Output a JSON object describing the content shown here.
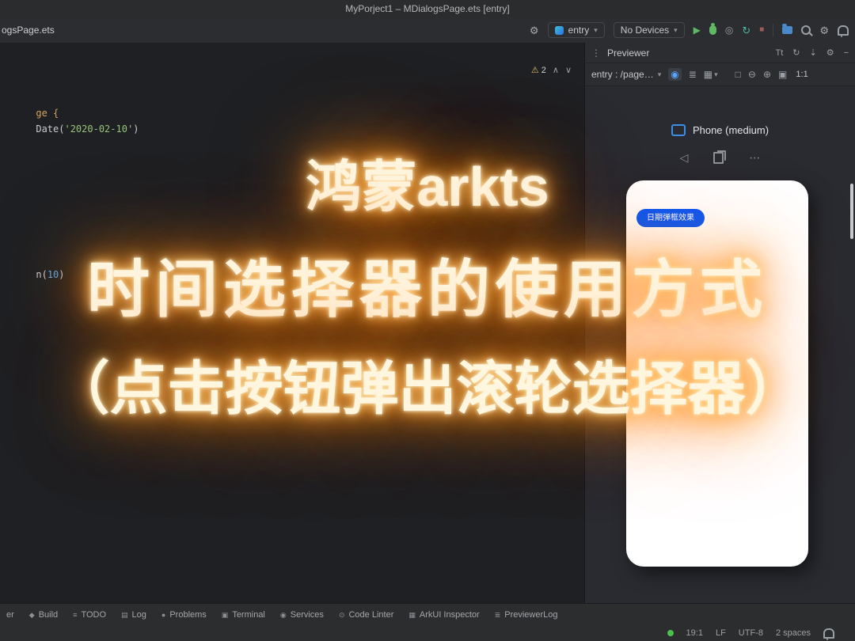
{
  "window": {
    "title": "MyPorject1 – MDialogsPage.ets [entry]"
  },
  "toolbar": {
    "tab_label": "ogsPage.ets",
    "run_config": "entry",
    "device_selector": "No Devices"
  },
  "editor": {
    "warnings": {
      "count": "2"
    },
    "code_fragments": [
      {
        "tokens": [
          {
            "text": "ge {",
            "color": "#d7a65f"
          }
        ]
      },
      {
        "tokens": [
          {
            "text": "Date(",
            "color": "#c9ccd1"
          },
          {
            "text": "'2020-02-10'",
            "color": "#98c379"
          },
          {
            "text": ")",
            "color": "#c9ccd1"
          }
        ]
      },
      {
        "tokens": [
          {
            "text": "n(",
            "color": "#c9ccd1"
          },
          {
            "text": "10",
            "color": "#56a8f5"
          },
          {
            "text": ")",
            "color": "#c9ccd1"
          }
        ]
      }
    ]
  },
  "previewer": {
    "title": "Previewer",
    "route": "entry : /page…",
    "font_icon": "Tt",
    "zoom_ratio": "1:1",
    "device_name": "Phone (medium)",
    "screen_button": "日期弹框效果"
  },
  "overlay": {
    "line1": "鸿蒙arkts",
    "line2": "时间选择器的使用方式",
    "line3": "（点击按钮弹出滚轮选择器）"
  },
  "statusbar": {
    "tools": [
      {
        "icon": "",
        "label": "er"
      },
      {
        "icon": "◆",
        "label": "Build"
      },
      {
        "icon": "≡",
        "label": "TODO"
      },
      {
        "icon": "▤",
        "label": "Log"
      },
      {
        "icon": "●",
        "label": "Problems"
      },
      {
        "icon": "▣",
        "label": "Terminal"
      },
      {
        "icon": "◉",
        "label": "Services"
      },
      {
        "icon": "⊙",
        "label": "Code Linter"
      },
      {
        "icon": "▦",
        "label": "ArkUI Inspector"
      },
      {
        "icon": "≣",
        "label": "PreviewerLog"
      }
    ],
    "caret_position": "19:1",
    "line_ending": "LF",
    "encoding": "UTF-8",
    "indent": "2 spaces"
  },
  "icons": {
    "gear": "⚙",
    "caret_down": "▾",
    "play": "▶",
    "profile": "◎",
    "refresh": "↻",
    "stop": "■",
    "warning": "⚠",
    "up": "∧",
    "down": "∨",
    "kebab": "⋮",
    "collapse": "⇣",
    "minimize": "−",
    "eye": "◉",
    "layers": "≣",
    "grid": "▦",
    "frame": "□",
    "zoom_out": "⊖",
    "zoom_in": "⊕",
    "fit": "▣",
    "back": "◁",
    "more": "⋯"
  },
  "colors": {
    "accent_blue": "#0a59f7",
    "glow_orange": "#ff8a12",
    "run_green": "#5fb865",
    "warning_yellow": "#e8bf6a",
    "string_green": "#98c379",
    "number_blue": "#56a8f5",
    "keyword_orange": "#d7a65f"
  }
}
